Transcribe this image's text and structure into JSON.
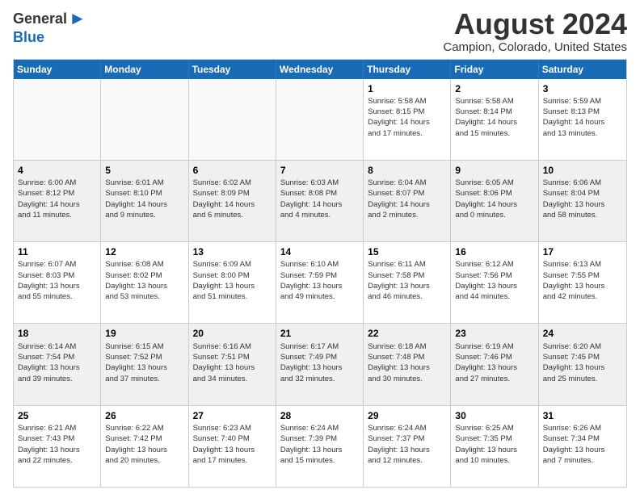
{
  "logo": {
    "general": "General",
    "blue": "Blue"
  },
  "title": "August 2024",
  "location": "Campion, Colorado, United States",
  "headers": [
    "Sunday",
    "Monday",
    "Tuesday",
    "Wednesday",
    "Thursday",
    "Friday",
    "Saturday"
  ],
  "rows": [
    [
      {
        "day": "",
        "info": ""
      },
      {
        "day": "",
        "info": ""
      },
      {
        "day": "",
        "info": ""
      },
      {
        "day": "",
        "info": ""
      },
      {
        "day": "1",
        "info": "Sunrise: 5:58 AM\nSunset: 8:15 PM\nDaylight: 14 hours\nand 17 minutes."
      },
      {
        "day": "2",
        "info": "Sunrise: 5:58 AM\nSunset: 8:14 PM\nDaylight: 14 hours\nand 15 minutes."
      },
      {
        "day": "3",
        "info": "Sunrise: 5:59 AM\nSunset: 8:13 PM\nDaylight: 14 hours\nand 13 minutes."
      }
    ],
    [
      {
        "day": "4",
        "info": "Sunrise: 6:00 AM\nSunset: 8:12 PM\nDaylight: 14 hours\nand 11 minutes."
      },
      {
        "day": "5",
        "info": "Sunrise: 6:01 AM\nSunset: 8:10 PM\nDaylight: 14 hours\nand 9 minutes."
      },
      {
        "day": "6",
        "info": "Sunrise: 6:02 AM\nSunset: 8:09 PM\nDaylight: 14 hours\nand 6 minutes."
      },
      {
        "day": "7",
        "info": "Sunrise: 6:03 AM\nSunset: 8:08 PM\nDaylight: 14 hours\nand 4 minutes."
      },
      {
        "day": "8",
        "info": "Sunrise: 6:04 AM\nSunset: 8:07 PM\nDaylight: 14 hours\nand 2 minutes."
      },
      {
        "day": "9",
        "info": "Sunrise: 6:05 AM\nSunset: 8:06 PM\nDaylight: 14 hours\nand 0 minutes."
      },
      {
        "day": "10",
        "info": "Sunrise: 6:06 AM\nSunset: 8:04 PM\nDaylight: 13 hours\nand 58 minutes."
      }
    ],
    [
      {
        "day": "11",
        "info": "Sunrise: 6:07 AM\nSunset: 8:03 PM\nDaylight: 13 hours\nand 55 minutes."
      },
      {
        "day": "12",
        "info": "Sunrise: 6:08 AM\nSunset: 8:02 PM\nDaylight: 13 hours\nand 53 minutes."
      },
      {
        "day": "13",
        "info": "Sunrise: 6:09 AM\nSunset: 8:00 PM\nDaylight: 13 hours\nand 51 minutes."
      },
      {
        "day": "14",
        "info": "Sunrise: 6:10 AM\nSunset: 7:59 PM\nDaylight: 13 hours\nand 49 minutes."
      },
      {
        "day": "15",
        "info": "Sunrise: 6:11 AM\nSunset: 7:58 PM\nDaylight: 13 hours\nand 46 minutes."
      },
      {
        "day": "16",
        "info": "Sunrise: 6:12 AM\nSunset: 7:56 PM\nDaylight: 13 hours\nand 44 minutes."
      },
      {
        "day": "17",
        "info": "Sunrise: 6:13 AM\nSunset: 7:55 PM\nDaylight: 13 hours\nand 42 minutes."
      }
    ],
    [
      {
        "day": "18",
        "info": "Sunrise: 6:14 AM\nSunset: 7:54 PM\nDaylight: 13 hours\nand 39 minutes."
      },
      {
        "day": "19",
        "info": "Sunrise: 6:15 AM\nSunset: 7:52 PM\nDaylight: 13 hours\nand 37 minutes."
      },
      {
        "day": "20",
        "info": "Sunrise: 6:16 AM\nSunset: 7:51 PM\nDaylight: 13 hours\nand 34 minutes."
      },
      {
        "day": "21",
        "info": "Sunrise: 6:17 AM\nSunset: 7:49 PM\nDaylight: 13 hours\nand 32 minutes."
      },
      {
        "day": "22",
        "info": "Sunrise: 6:18 AM\nSunset: 7:48 PM\nDaylight: 13 hours\nand 30 minutes."
      },
      {
        "day": "23",
        "info": "Sunrise: 6:19 AM\nSunset: 7:46 PM\nDaylight: 13 hours\nand 27 minutes."
      },
      {
        "day": "24",
        "info": "Sunrise: 6:20 AM\nSunset: 7:45 PM\nDaylight: 13 hours\nand 25 minutes."
      }
    ],
    [
      {
        "day": "25",
        "info": "Sunrise: 6:21 AM\nSunset: 7:43 PM\nDaylight: 13 hours\nand 22 minutes."
      },
      {
        "day": "26",
        "info": "Sunrise: 6:22 AM\nSunset: 7:42 PM\nDaylight: 13 hours\nand 20 minutes."
      },
      {
        "day": "27",
        "info": "Sunrise: 6:23 AM\nSunset: 7:40 PM\nDaylight: 13 hours\nand 17 minutes."
      },
      {
        "day": "28",
        "info": "Sunrise: 6:24 AM\nSunset: 7:39 PM\nDaylight: 13 hours\nand 15 minutes."
      },
      {
        "day": "29",
        "info": "Sunrise: 6:24 AM\nSunset: 7:37 PM\nDaylight: 13 hours\nand 12 minutes."
      },
      {
        "day": "30",
        "info": "Sunrise: 6:25 AM\nSunset: 7:35 PM\nDaylight: 13 hours\nand 10 minutes."
      },
      {
        "day": "31",
        "info": "Sunrise: 6:26 AM\nSunset: 7:34 PM\nDaylight: 13 hours\nand 7 minutes."
      }
    ]
  ]
}
